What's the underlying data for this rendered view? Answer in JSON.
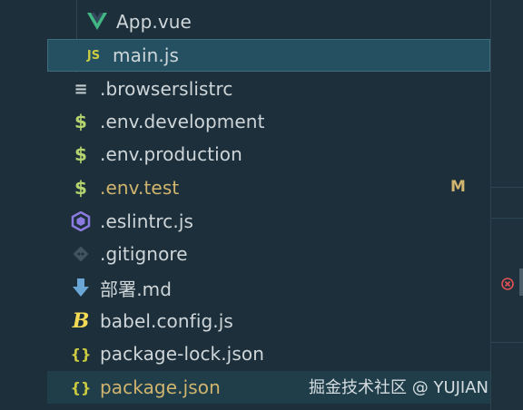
{
  "explorer": {
    "files": [
      {
        "name": "App.vue",
        "icon": "vue-icon",
        "glyph": "V",
        "color": "#41b883"
      },
      {
        "name": "main.js",
        "icon": "javascript-icon",
        "glyph": "JS",
        "color": "#cbcb41"
      },
      {
        "name": ".browserslistrc",
        "icon": "text-lines-icon",
        "glyph": "≡",
        "color": "#c5ccd0"
      },
      {
        "name": ".env.development",
        "icon": "dollar-icon",
        "glyph": "$",
        "color": "#b5d46f"
      },
      {
        "name": ".env.production",
        "icon": "dollar-icon",
        "glyph": "$",
        "color": "#b5d46f"
      },
      {
        "name": ".env.test",
        "icon": "dollar-icon",
        "glyph": "$",
        "color": "#b5d46f",
        "status": "M"
      },
      {
        "name": ".eslintrc.js",
        "icon": "eslint-icon",
        "glyph": "⬡",
        "color": "#8b7be0"
      },
      {
        "name": ".gitignore",
        "icon": "git-icon",
        "glyph": "◆",
        "color": "#4a5c66"
      },
      {
        "name": "部署.md",
        "icon": "markdown-download-icon",
        "glyph": "⬇",
        "color": "#6aa6d6"
      },
      {
        "name": "babel.config.js",
        "icon": "babel-icon",
        "glyph": "B",
        "color": "#f5da55"
      },
      {
        "name": "package-lock.json",
        "icon": "json-braces-icon",
        "glyph": "{}",
        "color": "#cbcb41"
      },
      {
        "name": "package.json",
        "icon": "json-braces-icon",
        "glyph": "{}",
        "color": "#cbcb41"
      }
    ],
    "env_test_status": "M",
    "env_test_color": "#d1b56e"
  },
  "watermark": "掘金技术社区 @ YUJIAN"
}
